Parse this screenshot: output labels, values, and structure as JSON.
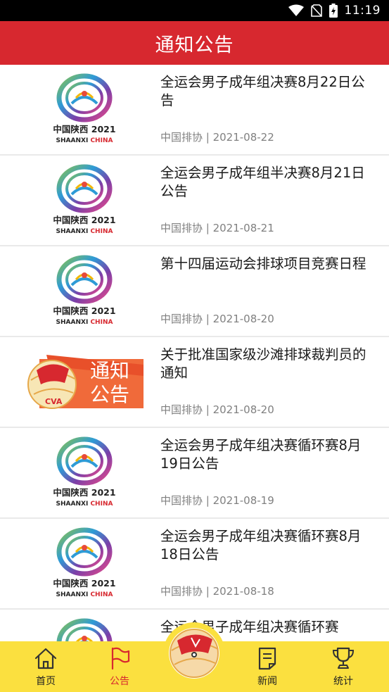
{
  "status_bar": {
    "time": "11:19"
  },
  "header": {
    "title": "通知公告"
  },
  "colors": {
    "brand_red": "#d7282f",
    "nav_yellow": "#fbe03f",
    "meta_gray": "#808080"
  },
  "logo_caption": {
    "line1": "中国陕西 2021",
    "line2_a": "SHAANXI",
    "line2_b": "CHINA"
  },
  "banner_text": {
    "line1": "通知",
    "line2": "公告",
    "badge": "CVA"
  },
  "items": [
    {
      "title": "全运会男子成年组决赛8月22日公告",
      "meta": "中国排协 | 2021-08-22",
      "thumb": "games-logo"
    },
    {
      "title": "全运会男子成年组半决赛8月21日公告",
      "meta": "中国排协 | 2021-08-21",
      "thumb": "games-logo"
    },
    {
      "title": "第十四届运动会排球项目竞赛日程",
      "meta": "中国排协 | 2021-08-20",
      "thumb": "games-logo"
    },
    {
      "title": "关于批准国家级沙滩排球裁判员的通知",
      "meta": "中国排协 | 2021-08-20",
      "thumb": "notice-banner"
    },
    {
      "title": "全运会男子成年组决赛循环赛8月19日公告",
      "meta": "中国排协 | 2021-08-19",
      "thumb": "games-logo"
    },
    {
      "title": "全运会男子成年组决赛循环赛8月18日公告",
      "meta": "中国排协 | 2021-08-18",
      "thumb": "games-logo"
    },
    {
      "title": "全运会男子成年组决赛循环赛",
      "meta": "",
      "thumb": "games-logo"
    }
  ],
  "bottom_nav": {
    "tabs": [
      {
        "label": "首页",
        "icon": "home-icon"
      },
      {
        "label": "公告",
        "icon": "flag-icon",
        "active": true
      },
      {
        "label": "新闻",
        "icon": "document-icon"
      },
      {
        "label": "统计",
        "icon": "trophy-icon"
      }
    ],
    "center_icon": "volleyball-logo-icon"
  }
}
